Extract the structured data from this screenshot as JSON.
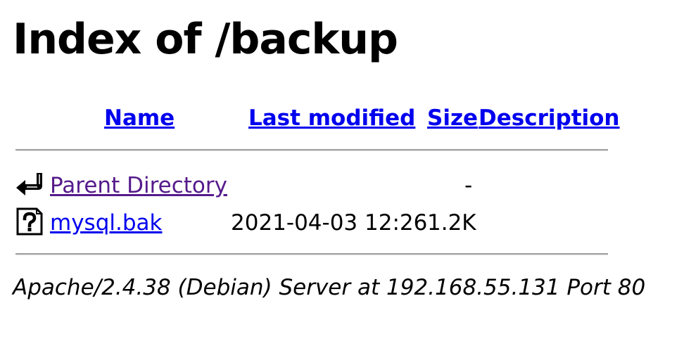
{
  "page": {
    "title": "Index of /backup"
  },
  "columns": {
    "name": "Name",
    "last_modified": "Last modified",
    "size": "Size",
    "description": "Description"
  },
  "rows": [
    {
      "icon": "back-icon",
      "name": "Parent Directory",
      "last_modified": "",
      "size": "-",
      "description": ""
    },
    {
      "icon": "unknown-file-icon",
      "name": "mysql.bak",
      "last_modified": "2021-04-03 12:26",
      "size": "1.2K",
      "description": ""
    }
  ],
  "footer": {
    "address": "Apache/2.4.38 (Debian) Server at 192.168.55.131 Port 80"
  },
  "colors": {
    "link": "#0000ee",
    "visited_link": "#551a8b",
    "rule": "#a0a0a0"
  }
}
